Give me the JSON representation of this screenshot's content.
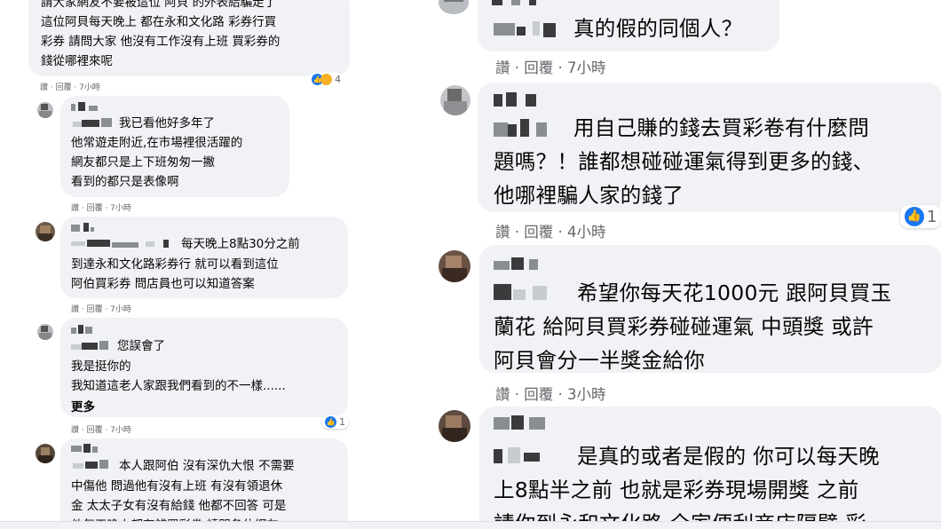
{
  "left_comments": [
    {
      "text": "請大家網友不要被這位 阿貝 的外表給騙走了\n這位阿貝每天晚上 都在永和文化路 彩券行買\n彩券 請問大家 他沒有工作沒有上班 買彩券的\n錢從哪裡來呢",
      "meta": "讚 · 回覆 · 7小時",
      "reactions": "4"
    },
    {
      "first_line": "我已看他好多年了",
      "text": "他常遊走附近,在市場裡很活躍的\n網友都只是上下班匆匆一撇\n看到的都只是表像啊",
      "meta": "讚 · 回覆 · 7小時"
    },
    {
      "first_line": "每天晚上8點30分之前",
      "text": "到達永和文化路彩券行 就可以看到這位\n阿伯買彩券 問店員也可以知道答案",
      "meta": "讚 · 回覆 · 7小時"
    },
    {
      "first_line": "您誤會了",
      "text": "我是挺你的\n我知道這老人家跟我們看到的不一樣......",
      "more": "更多",
      "meta": "讚 · 回覆 · 7小時",
      "reactions": "1"
    },
    {
      "first_line": "本人跟阿伯 沒有深仇大恨 不需要",
      "text": "中傷他 問過他有沒有上班 有沒有領退休\n金 太太子女有沒有給錢 他都不回答 可是\n他每天晚上都有錢買彩券 請問各位網友"
    }
  ],
  "right_comments": [
    {
      "text": "真的假的同個人？",
      "meta": "讚 · 回覆 · 7小時"
    },
    {
      "first_line": "用自己賺的錢去買彩卷有什麼問",
      "text": "題嗎？！誰都想碰碰運氣得到更多的錢、\n他哪裡騙人家的錢了",
      "meta": "讚 · 回覆 · 4小時",
      "reactions": "1"
    },
    {
      "first_line": "希望你每天花1000元 跟阿貝買玉",
      "text": "蘭花 給阿貝買彩券碰碰運氣 中頭獎 或許\n阿貝會分一半獎金給你",
      "meta": "讚 · 回覆 · 3小時"
    },
    {
      "first_line": "是真的或者是假的 你可以每天晚",
      "text": "上8點半之前 也就是彩券現場開獎 之前\n請你到永和文化路 全家便利商店隔壁 彩"
    }
  ],
  "icons": {
    "like": "like-icon",
    "haha": "haha-icon"
  },
  "colors": {
    "bubble": "#f0f2f5",
    "meta": "#65676b",
    "like": "#1877f2"
  }
}
